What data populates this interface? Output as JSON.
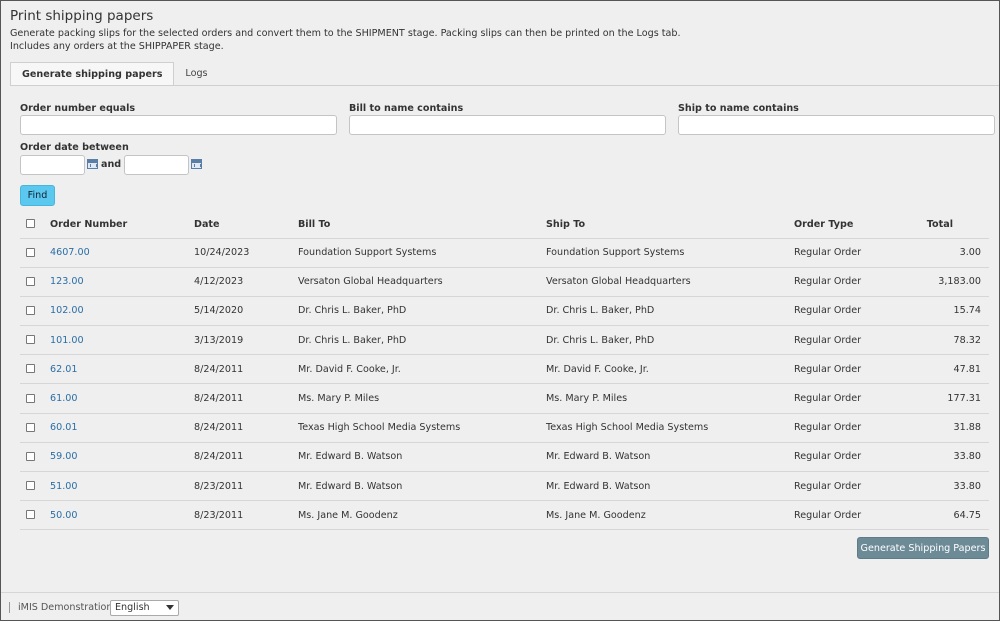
{
  "page": {
    "title": "Print shipping papers",
    "description_line1": "Generate packing slips for the selected orders and convert them to the SHIPMENT stage. Packing slips can then be printed on the Logs tab.",
    "description_line2": "Includes any orders at the SHIPPAPER stage."
  },
  "tabs": [
    {
      "label": "Generate shipping papers",
      "active": true
    },
    {
      "label": "Logs",
      "active": false
    }
  ],
  "filters": {
    "order_number_label": "Order number equals",
    "order_number_value": "",
    "bill_to_label": "Bill to name contains",
    "bill_to_value": "",
    "ship_to_label": "Ship to name contains",
    "ship_to_value": "",
    "date_label": "Order date between",
    "date_from_value": "",
    "date_and": "and",
    "date_to_value": "",
    "find_label": "Find"
  },
  "table": {
    "columns": [
      "Order Number",
      "Date",
      "Bill To",
      "Ship To",
      "Order Type",
      "Total"
    ],
    "rows": [
      {
        "order": "4607.00",
        "date": "10/24/2023",
        "bill_to": "Foundation Support Systems",
        "ship_to": "Foundation Support Systems",
        "type": "Regular Order",
        "total": "3.00"
      },
      {
        "order": "123.00",
        "date": "4/12/2023",
        "bill_to": "Versaton Global Headquarters",
        "ship_to": "Versaton Global Headquarters",
        "type": "Regular Order",
        "total": "3,183.00"
      },
      {
        "order": "102.00",
        "date": "5/14/2020",
        "bill_to": "Dr. Chris L. Baker, PhD",
        "ship_to": "Dr. Chris L. Baker, PhD",
        "type": "Regular Order",
        "total": "15.74"
      },
      {
        "order": "101.00",
        "date": "3/13/2019",
        "bill_to": "Dr. Chris L. Baker, PhD",
        "ship_to": "Dr. Chris L. Baker, PhD",
        "type": "Regular Order",
        "total": "78.32"
      },
      {
        "order": "62.01",
        "date": "8/24/2011",
        "bill_to": "Mr. David F. Cooke, Jr.",
        "ship_to": "Mr. David F. Cooke, Jr.",
        "type": "Regular Order",
        "total": "47.81"
      },
      {
        "order": "61.00",
        "date": "8/24/2011",
        "bill_to": "Ms. Mary P. Miles",
        "ship_to": "Ms. Mary P. Miles",
        "type": "Regular Order",
        "total": "177.31"
      },
      {
        "order": "60.01",
        "date": "8/24/2011",
        "bill_to": "Texas High School Media Systems",
        "ship_to": "Texas High School Media Systems",
        "type": "Regular Order",
        "total": "31.88"
      },
      {
        "order": "59.00",
        "date": "8/24/2011",
        "bill_to": "Mr. Edward B. Watson",
        "ship_to": "Mr. Edward B. Watson",
        "type": "Regular Order",
        "total": "33.80"
      },
      {
        "order": "51.00",
        "date": "8/23/2011",
        "bill_to": "Mr. Edward B. Watson",
        "ship_to": "Mr. Edward B. Watson",
        "type": "Regular Order",
        "total": "33.80"
      },
      {
        "order": "50.00",
        "date": "8/23/2011",
        "bill_to": "Ms. Jane M. Goodenz",
        "ship_to": "Ms. Jane M. Goodenz",
        "type": "Regular Order",
        "total": "64.75"
      }
    ]
  },
  "actions": {
    "generate_label": "Generate Shipping Papers"
  },
  "footer": {
    "site_name": "iMIS Demonstration",
    "language_selected": "English"
  },
  "colors": {
    "find_button": "#5bc8f0",
    "generate_button": "#6d8a97",
    "link": "#2a6ea6"
  },
  "icons": {
    "calendar": "calendar-icon",
    "dropdown": "chevron-down-icon"
  }
}
